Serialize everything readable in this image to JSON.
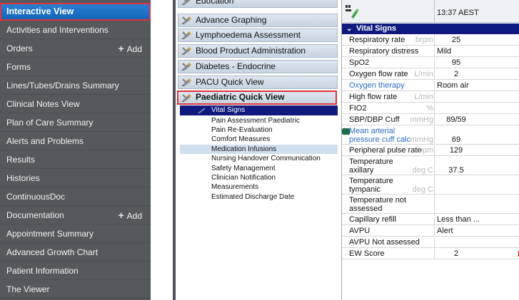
{
  "nav": {
    "items": [
      {
        "label": "Interactive View",
        "active": true
      },
      {
        "label": "Activities and Interventions"
      },
      {
        "label": "Orders",
        "add": "Add"
      },
      {
        "label": "Forms"
      },
      {
        "label": "Lines/Tubes/Drains Summary"
      },
      {
        "label": "Clinical Notes View"
      },
      {
        "label": "Plan of Care Summary"
      },
      {
        "label": "Alerts and Problems"
      },
      {
        "label": "Results"
      },
      {
        "label": "Histories"
      },
      {
        "label": "ContinuousDoc"
      },
      {
        "label": "Documentation",
        "add": "Add"
      },
      {
        "label": "Appointment Summary"
      },
      {
        "label": "Advanced Growth Chart"
      },
      {
        "label": "Patient Information"
      },
      {
        "label": "The Viewer"
      }
    ]
  },
  "bands": {
    "items": [
      {
        "label": "Education"
      },
      {
        "label": "Advance Graphing"
      },
      {
        "label": "Lymphoedema Assessment"
      },
      {
        "label": "Blood Product Administration"
      },
      {
        "label": "Diabetes - Endocrine"
      },
      {
        "label": "PACU Quick View"
      },
      {
        "label": "Paediatric Quick View",
        "open": true
      }
    ],
    "sub_items": [
      {
        "label": "Vital Signs",
        "selected": true
      },
      {
        "label": "Pain Assessment Paediatric"
      },
      {
        "label": "Pain Re-Evaluation"
      },
      {
        "label": "Comfort Measures"
      },
      {
        "label": "Medication Infusions",
        "highlighted": true
      },
      {
        "label": "Nursing Handover Communication"
      },
      {
        "label": "Safety Management"
      },
      {
        "label": "Clinician Notification"
      },
      {
        "label": "Measurements"
      },
      {
        "label": "Estimated Discharge Date"
      }
    ]
  },
  "sheet": {
    "column_time": "13:37 AEST",
    "section": "Vital Signs",
    "rows": [
      {
        "label": [
          "Respiratory rate"
        ],
        "unit": "brpm",
        "value": "25"
      },
      {
        "label": [
          "Respiratory distress"
        ],
        "unit": "",
        "value": "Mild"
      },
      {
        "label": [
          "SpO2"
        ],
        "unit": "",
        "value": "95"
      },
      {
        "label": [
          "Oxygen flow rate"
        ],
        "unit": "L/min",
        "value": "2"
      },
      {
        "label": [
          "Oxygen therapy"
        ],
        "unit": "",
        "value": "Room air",
        "link": true
      },
      {
        "label": [
          "High flow rate"
        ],
        "unit": "L/min",
        "value": ""
      },
      {
        "label": [
          "FIO2"
        ],
        "unit": "%",
        "value": ""
      },
      {
        "label": [
          "SBP/DBP Cuff"
        ],
        "unit": "mmHg",
        "value": "89/59"
      },
      {
        "label": [
          "Mean arterial",
          "pressure cuff calc"
        ],
        "unit": "mmHg",
        "value": "69",
        "link": true,
        "doc_icon": true
      },
      {
        "label": [
          "Peripheral pulse rate"
        ],
        "unit": "bpm",
        "value": "129"
      },
      {
        "label": [
          "Temperature",
          "axillary"
        ],
        "unit": "deg C",
        "value": "37.5"
      },
      {
        "label": [
          "Temperature",
          "tympanic"
        ],
        "unit": "deg C",
        "value": ""
      },
      {
        "label": [
          "Temperature not",
          "assessed"
        ],
        "unit": "",
        "value": ""
      },
      {
        "label": [
          "Capillary refill"
        ],
        "unit": "",
        "value": "Less than ..."
      },
      {
        "label": [
          "AVPU"
        ],
        "unit": "",
        "value": "Alert"
      },
      {
        "label": [
          "AVPU Not assessed"
        ],
        "unit": "",
        "value": ""
      },
      {
        "label": [
          "EW Score"
        ],
        "unit": "",
        "value": "2"
      }
    ]
  },
  "colors": {
    "nav_bg": "#55595c",
    "nav_active": "#1f72c6",
    "highlight_box": "#e0323a",
    "selected_navy": "#0e1a7d",
    "link_blue": "#2a6cc9"
  }
}
